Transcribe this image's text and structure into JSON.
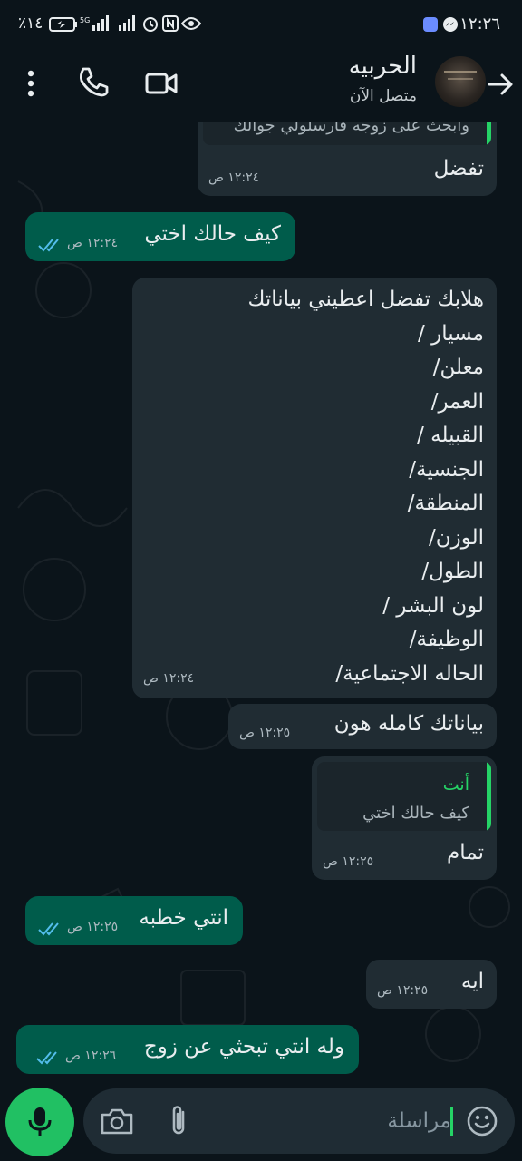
{
  "status_bar": {
    "time": "١٢:٢٦",
    "battery": "٪١٤",
    "network": "5G"
  },
  "header": {
    "contact_name": "الحربيه",
    "contact_status": "متصل الآن"
  },
  "messages": [
    {
      "id": 0,
      "dir": "in",
      "quoted_text": "وابحث على زوجه فارسلولي جوالك",
      "text": "تفضل",
      "time": "١٢:٢٤ ص"
    },
    {
      "id": 1,
      "dir": "out",
      "text": "كيف حالك اختي",
      "time": "١٢:٢٤ ص"
    },
    {
      "id": 2,
      "dir": "in",
      "lines": [
        "هلابك تفضل اعطيني بياناتك",
        "مسيار /",
        "معلن/",
        "العمر/",
        "القبيله /",
        "الجنسية/",
        "المنطقة/",
        "الوزن/",
        "الطول/",
        "لون البشر /",
        "الوظيفة/",
        "الحاله الاجتماعية/"
      ],
      "time": "١٢:٢٤ ص"
    },
    {
      "id": 3,
      "dir": "in",
      "text": "بياناتك كامله هون",
      "time": "١٢:٢٥ ص"
    },
    {
      "id": 4,
      "dir": "in",
      "quoted_author": "أنت",
      "quoted_text": "كيف حالك اختي",
      "text": "تمام",
      "time": "١٢:٢٥ ص"
    },
    {
      "id": 5,
      "dir": "out",
      "text": "انتي خطبه",
      "time": "١٢:٢٥ ص"
    },
    {
      "id": 6,
      "dir": "in",
      "text": "ايه",
      "time": "١٢:٢٥ ص"
    },
    {
      "id": 7,
      "dir": "out",
      "text": "وله انتي تبحثي عن زوج",
      "time": "١٢:٢٦ ص"
    }
  ],
  "input": {
    "placeholder": "مراسلة"
  },
  "colors": {
    "background": "#0b141a",
    "incoming_bubble": "#202c33",
    "outgoing_bubble": "#005c4b",
    "accent_green": "#25d366",
    "mic_button": "#21c063",
    "read_ticks": "#53bdeb"
  },
  "icons": {
    "back": "arrow-right-icon",
    "video": "video-camera-icon",
    "call": "phone-icon",
    "menu": "more-vertical-icon",
    "emoji": "emoji-icon",
    "attach": "paperclip-icon",
    "camera": "camera-icon",
    "mic": "microphone-icon",
    "read_receipt": "double-check-icon"
  }
}
